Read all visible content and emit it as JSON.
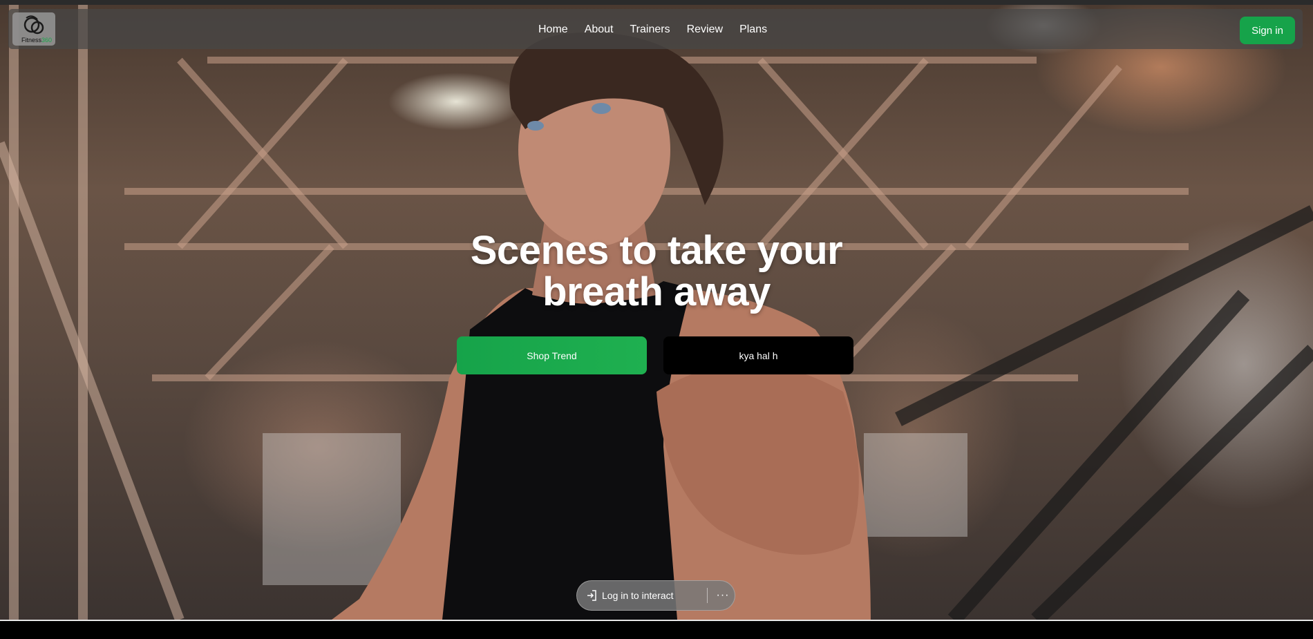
{
  "brand": {
    "logo_text": "Fitness",
    "logo_number": "360",
    "accent": "#16a34a"
  },
  "nav": {
    "links": [
      "Home",
      "About",
      "Trainers",
      "Review",
      "Plans"
    ],
    "signin_label": "Sign in"
  },
  "hero": {
    "headline_line1": "Scenes to take your",
    "headline_line2": "breath away",
    "primary_button": "Shop Trend",
    "secondary_button": "kya hal h"
  },
  "overlay": {
    "login_label": "Log in to interact",
    "login_icon": "login-arrow-icon",
    "more_icon": "more-horizontal-icon"
  }
}
